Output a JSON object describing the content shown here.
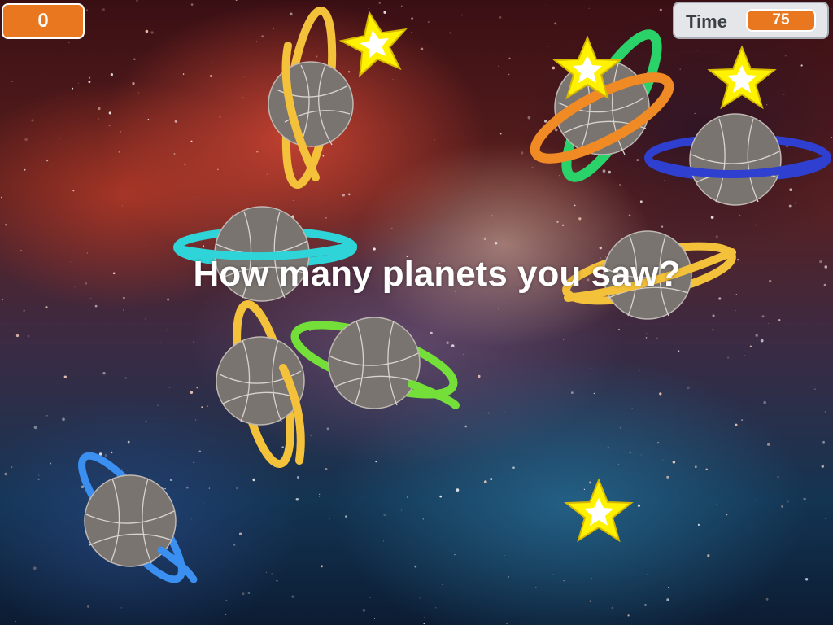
{
  "game": {
    "score": "0",
    "timer": {
      "label": "Time",
      "value": "75"
    },
    "question": "How many planets you saw?"
  },
  "planets": [
    {
      "id": 1,
      "ring_color": "#f4c13a"
    },
    {
      "id": 2,
      "ring_color": "#f08a24"
    },
    {
      "id": 3,
      "ring_color": "#2f3fd0"
    },
    {
      "id": 4,
      "ring_color": "#2ed4d8"
    },
    {
      "id": 5,
      "ring_color": "#f4c13a"
    },
    {
      "id": 6,
      "ring_color": "#f4c13a"
    },
    {
      "id": 7,
      "ring_color": "#75df3a"
    },
    {
      "id": 8,
      "ring_color": "#3a8ff0"
    }
  ],
  "stars_count": 4,
  "colors": {
    "score_box": "#e8771f",
    "planet_body": "#7a7470",
    "star": "#fff200",
    "star_center": "#ffffff"
  }
}
